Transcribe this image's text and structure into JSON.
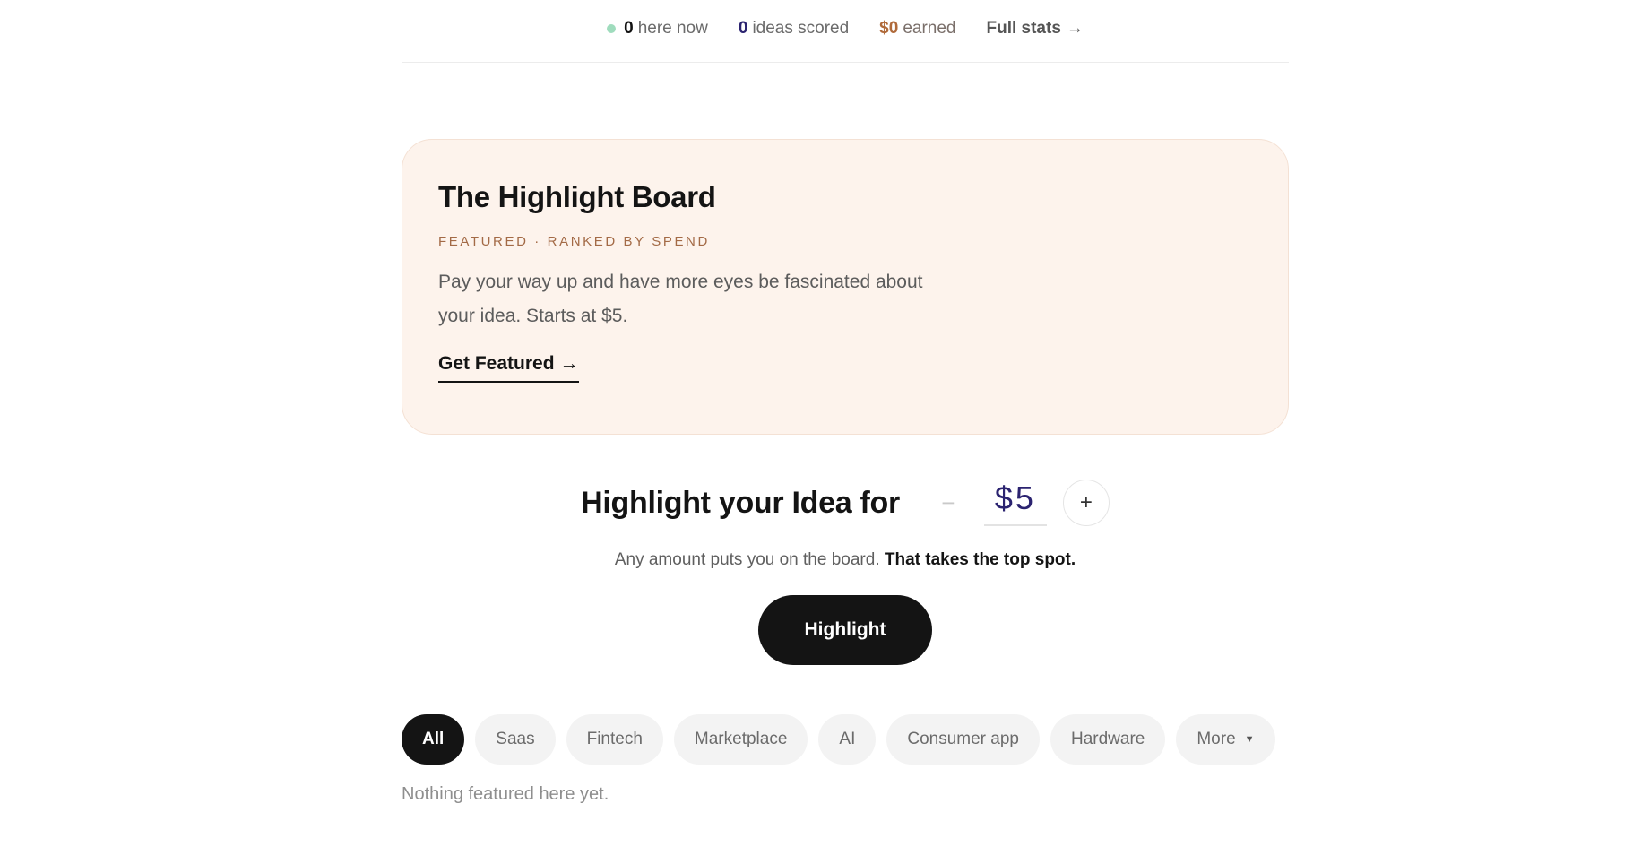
{
  "stats": {
    "here_now_count": "0",
    "here_now_label": "here now",
    "ideas_scored_count": "0",
    "ideas_scored_label": "ideas scored",
    "earned_amount": "$0",
    "earned_label": "earned",
    "full_stats_label": "Full stats",
    "arrow": "→"
  },
  "board": {
    "title": "The Highlight Board",
    "eyebrow": "FEATURED · RANKED BY SPEND",
    "description": "Pay your way up and have more eyes be fascinated about your idea. Starts at $5.",
    "cta_label": "Get Featured",
    "cta_arrow": "→"
  },
  "highlight": {
    "heading": "Highlight your Idea for",
    "minus": "−",
    "amount": "$5",
    "plus": "+",
    "note_prefix": "Any amount puts you on the board.",
    "note_bold": "That takes the top spot.",
    "button_label": "Highlight"
  },
  "filters": {
    "chips": [
      {
        "label": "All",
        "active": true
      },
      {
        "label": "Saas"
      },
      {
        "label": "Fintech"
      },
      {
        "label": "Marketplace"
      },
      {
        "label": "AI"
      },
      {
        "label": "Consumer app"
      },
      {
        "label": "Hardware"
      },
      {
        "label": "More",
        "caret": "▼"
      }
    ]
  },
  "empty_state": "Nothing featured here yet.",
  "colors": {
    "card_bg": "#fdf3ec",
    "accent_navy": "#2b2370",
    "accent_copper": "#a36a46",
    "live_dot": "#9fdcbd",
    "dark": "#141414"
  }
}
